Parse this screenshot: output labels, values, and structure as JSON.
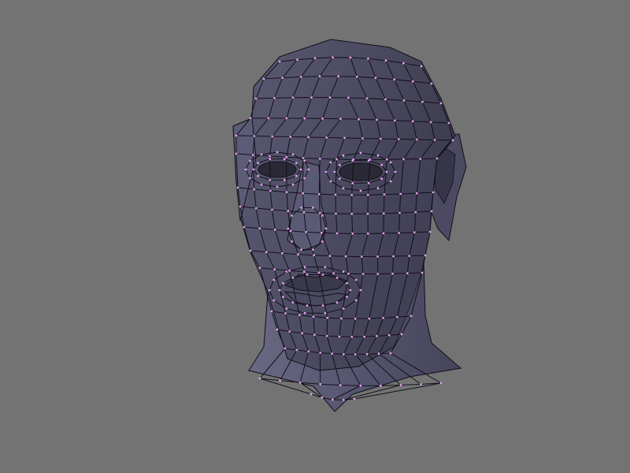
{
  "viewport": {
    "background": "#737373",
    "content": "wireframe-head-mesh"
  },
  "mesh": {
    "face_color": "#4f4e66",
    "face_shadow": "#3a394c",
    "face_highlight": "#6e6d87",
    "edge_color": "#111018",
    "vertex_color": "#e69ff0",
    "cavity_color": "#2a2936"
  }
}
